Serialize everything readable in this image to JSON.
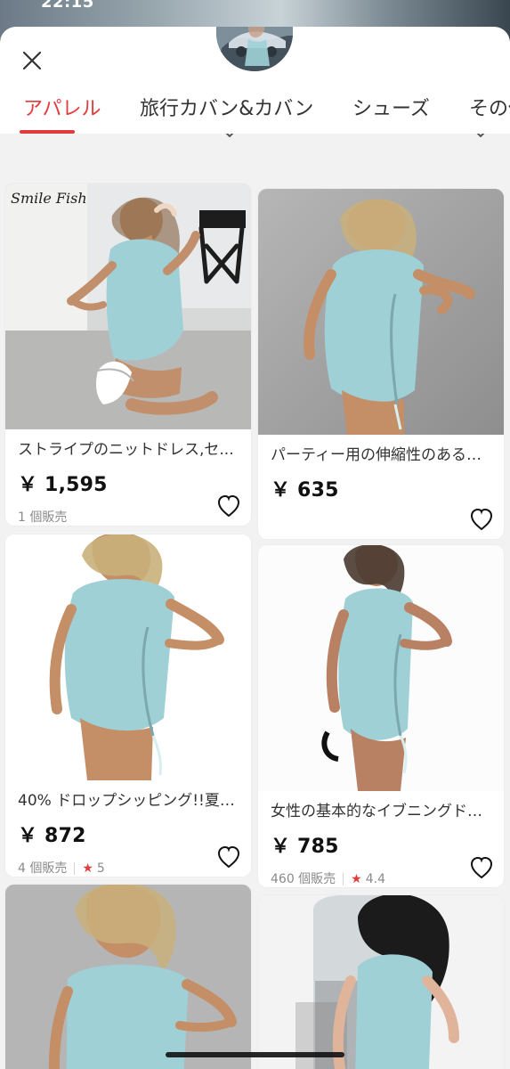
{
  "status": {
    "time": "22:15"
  },
  "header": {
    "tabs": [
      {
        "label": "アパレル",
        "active": true
      },
      {
        "label": "旅行カバン&カバン",
        "active": false
      },
      {
        "label": "シューズ",
        "active": false
      },
      {
        "label": "その他",
        "active": false
      }
    ],
    "icons": {
      "close": "close-icon",
      "avatar": "store-avatar"
    }
  },
  "products": [
    {
      "brand_overlay": "Smile Fish",
      "title": "ストライプのニットドレス,セ...",
      "price": "￥ 1,595",
      "sold": "1 個販売",
      "rating": ""
    },
    {
      "brand_overlay": "",
      "title": "パーティー用の伸縮性のあるリ...",
      "price": "￥ 635",
      "sold": "",
      "rating": ""
    },
    {
      "brand_overlay": "",
      "title": "40% ドロップシッピング!!夏の...",
      "price": "￥ 872",
      "sold": "4 個販売",
      "rating": "5"
    },
    {
      "brand_overlay": "",
      "title": "女性の基本的なイブニングドレ...",
      "price": "￥ 785",
      "sold": "460 個販売",
      "rating": "4.4"
    },
    {
      "brand_overlay": "",
      "title": "",
      "price": "",
      "sold": "",
      "rating": ""
    },
    {
      "brand_overlay": "",
      "title": "",
      "price": "",
      "sold": "",
      "rating": ""
    }
  ],
  "colors": {
    "accent": "#e23b3b",
    "background": "#f2f2f2",
    "dress": "#9fd0d6"
  }
}
